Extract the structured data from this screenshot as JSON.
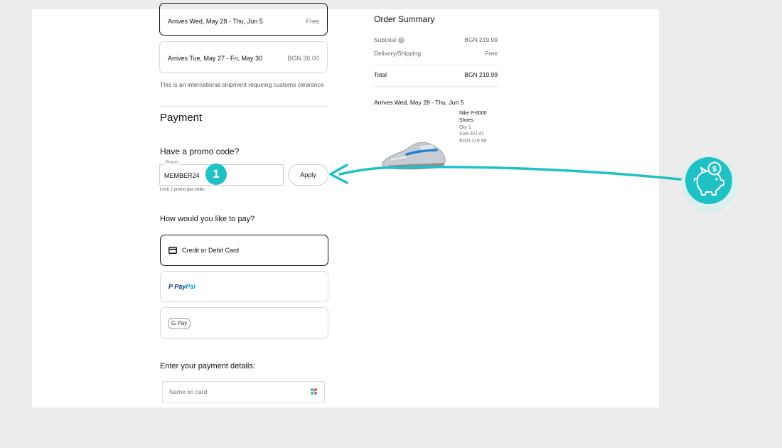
{
  "shipping": {
    "options": [
      {
        "label": "Arrives Wed, May 28 - Thu, Jun 5",
        "price": "Free",
        "selected": true
      },
      {
        "label": "Arrives Tue, May 27 - Fri, May 30",
        "price": "BGN 30.00",
        "selected": false
      }
    ],
    "note": "This is an international shipment requiring customs clearance"
  },
  "payment": {
    "title": "Payment",
    "promo": {
      "heading": "Have a promo code?",
      "field_label": "Promo",
      "value": "MEMBER24",
      "apply_label": "Apply",
      "limit_note": "Limit 1 promo per order.",
      "step_badge": "1"
    },
    "methods_heading": "How would you like to pay?",
    "methods": {
      "card_label": "Credit or Debit Card",
      "paypal_p": "P",
      "paypal_pay": "Pay",
      "paypal_pal": "Pal",
      "gpay_label": "G Pay"
    },
    "details_heading": "Enter your payment details:",
    "name_placeholder": "Name on card"
  },
  "order_summary": {
    "title": "Order Summary",
    "subtotal_label": "Subtotal",
    "subtotal_help": "?",
    "subtotal_value": "BGN 219.99",
    "delivery_label": "Delivery/Shipping",
    "delivery_value": "Free",
    "total_label": "Total",
    "total_value": "BGN 219.99",
    "arrives": "Arrives Wed, May 28 - Thu, Jun 5",
    "product": {
      "name_line1": "Nike P-6000",
      "name_line2": "Shoes",
      "qty": "Qty 1",
      "size": "Size EU 41",
      "price": "BGN 219.99"
    }
  },
  "colors": {
    "accent": "#20c1c4",
    "page_bg": "#ececec",
    "border_selected": "#111111",
    "border": "#d9d9d9"
  },
  "icons": [
    "credit-card-icon",
    "paypal-logo",
    "google-pay-logo",
    "contacts-icon",
    "piggy-bank-icon",
    "dollar-coin-icon",
    "arrow-icon"
  ]
}
